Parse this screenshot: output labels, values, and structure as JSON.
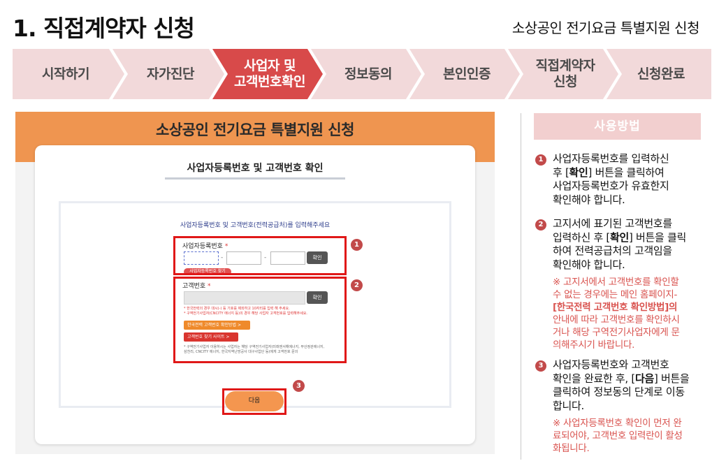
{
  "header": {
    "title": "1. 직접계약자 신청",
    "subtitle": "소상공인 전기요금 특별지원 신청"
  },
  "steps": [
    {
      "label": "시작하기",
      "active": false
    },
    {
      "label": "자가진단",
      "active": false
    },
    {
      "label": "사업자 및 고객번호확인",
      "line1": "사업자 및",
      "line2": "고객번호확인",
      "active": true
    },
    {
      "label": "정보동의",
      "active": false
    },
    {
      "label": "본인인증",
      "active": false
    },
    {
      "label": "직접계약자 신청",
      "line1": "직접계약자",
      "line2": "신청",
      "active": false
    },
    {
      "label": "신청완료",
      "active": false
    }
  ],
  "form": {
    "header_title": "소상공인 전기요금 특별지원 신청",
    "card_title": "사업자등록번호 및 고객번호 확인",
    "prompt": "사업자등록번호 및 고객번호(전력공급처)를 입력해주세요",
    "business_label": "사업자등록번호",
    "required_mark": "*",
    "business_value_1": "",
    "business_value_2": "",
    "business_value_3": "",
    "dash": "-",
    "confirm_label": "확인",
    "find_business_label": "사업자등록번호 찾기",
    "customer_label": "고객번호",
    "customer_value": "",
    "customer_notes": [
      "* 한국전력의 경우 대시(-) 등 기호를 제외하고 10자리를 입력 해 주세요.",
      "* 구역전기사업자(CNCITY 에너지 등)의 경우 해당 사업자 고객번호를 입력해주세요."
    ],
    "kepco_method_label": "한국전력 고객번호 확인방법 >",
    "find_customer_site_label": "고객번호 찾기 사이트 >",
    "bottom_notes": [
      "* 구역전기사업자 이용하시는 사업자는 해당 구역전기사업자(미래엔서해에너지, 부산정관에너지,",
      "삼천리, CNCITY 에너지, 한국지역난방공사 대구사업단 등)에게 고객번호 문의"
    ],
    "next_label": "다음",
    "badges": [
      "1",
      "2",
      "3"
    ]
  },
  "instructions": {
    "title": "사용방법",
    "items": [
      {
        "num": "1",
        "lines": [
          "사업자등록번호를 입력하신",
          "후 [확인] 버튼을 클릭하여",
          "사업자등록번호가 유효한지",
          "확인해야 합니다."
        ]
      },
      {
        "num": "2",
        "lines": [
          "고지서에 표기된 고객번호를",
          "입력하신 후 [확인] 버튼을 클릭",
          "하여 전력공급처의 고객임을",
          "확인해야 합니다."
        ],
        "note_lines": [
          "※ 고지서에서 고객번호를 확인할",
          "수 없는 경우에는 메인 홈페이지-",
          "[한국전력 고객번호 확인방법]의",
          "안내에 따라 고객번호를 확인하시",
          "거나 해당 구역전기사업자에게 문",
          "의해주시기 바랍니다."
        ]
      },
      {
        "num": "3",
        "lines": [
          "사업자등록번호와 고객번호",
          "확인을 완료한 후, [다음] 버튼을",
          "클릭하여 정보동의 단계로 이동",
          "합니다."
        ],
        "note_lines": [
          "※ 사업자등록번호 확인이 먼저 완",
          "료되어야, 고객번호 입력란이 활성",
          "화됩니다."
        ]
      }
    ]
  },
  "colors": {
    "active_step": "#d84a4a",
    "inactive_step": "#f2d9da",
    "form_header": "#ef9550",
    "highlight": "#e01818",
    "badge": "#c24a4a",
    "note_text": "#d9534f"
  }
}
